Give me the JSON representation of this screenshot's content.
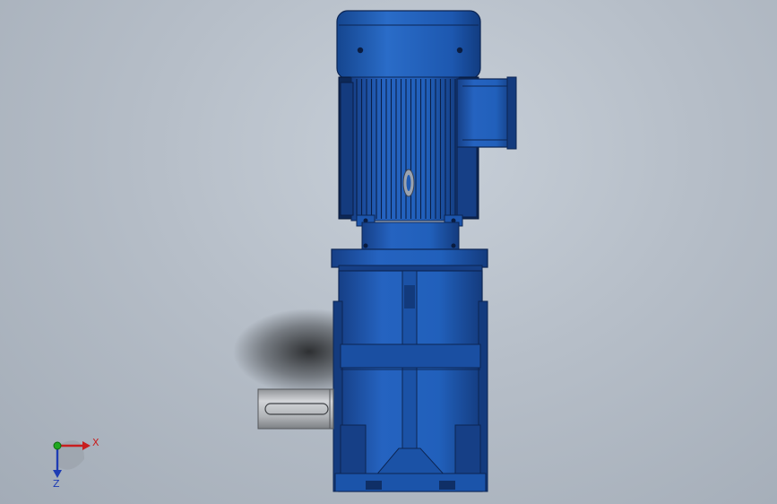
{
  "colors": {
    "background": "#b6bec8",
    "motor_blue": "#1e5ab4",
    "motor_dark": "#0f2f66",
    "shaft_grey": "#b9bcc0",
    "axis_x": "#c81e1e",
    "axis_y": "#1fa81f",
    "axis_z": "#1e3cb4"
  },
  "triad": {
    "x_label": "X",
    "z_label": "Z"
  },
  "icons": {
    "triad": "axis-triad-icon"
  }
}
